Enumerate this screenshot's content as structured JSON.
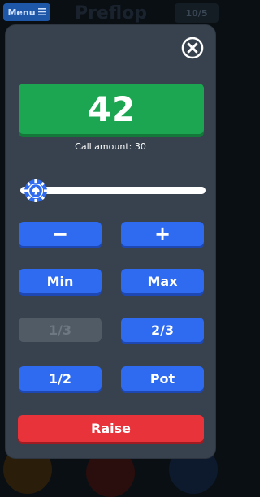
{
  "background": {
    "menu_label": "Menu",
    "menu_icon": "hamburger-icon",
    "stage_title": "Preflop",
    "blinds": "10/5"
  },
  "modal": {
    "close_icon": "close-icon",
    "amount": "42",
    "call_amount_label": "Call amount: 30",
    "slider_level": 0.02,
    "buttons": {
      "minus": "−",
      "plus": "+",
      "min": "Min",
      "max": "Max",
      "third": "1/3",
      "two_thirds": "2/3",
      "half": "1/2",
      "pot": "Pot"
    },
    "raise_label": "Raise"
  },
  "colors": {
    "modal_bg": "#37424e",
    "amount_green": "#1ca651",
    "button_blue": "#2f6bf0",
    "raise_red": "#e8333a",
    "disabled_gray": "#515b66"
  }
}
